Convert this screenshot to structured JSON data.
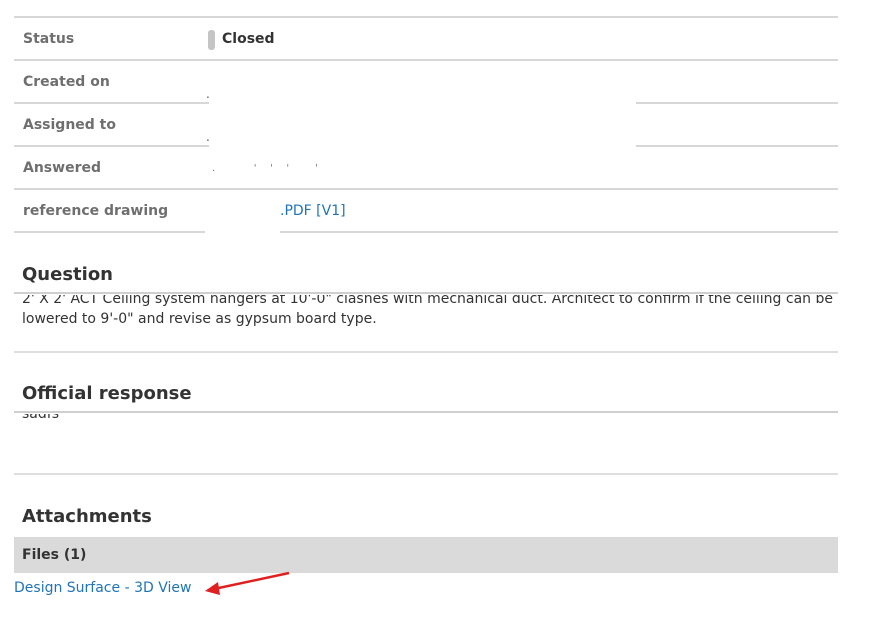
{
  "details": {
    "status_label": "Status",
    "status_value": "Closed",
    "created_label": "Created on",
    "assigned_label": "Assigned to",
    "answered_label": "Answered",
    "reference_label": "reference drawing",
    "reference_link": ".PDF [V1]"
  },
  "question": {
    "title": "Question",
    "line1": "2' X 2' ACT Ceiling system hangers at 10'-0\" clashes with mechanical duct. Architect to confirm if the ceiling can be",
    "line2": "lowered to 9'-0\" and revise as gypsum board type."
  },
  "response": {
    "title": "Official response",
    "text": "sadfs"
  },
  "attachments": {
    "title": "Attachments",
    "files_header": "Files (1)",
    "file_link": "Design Surface - 3D View"
  },
  "colors": {
    "link": "#1f74b8",
    "arrow": "#e02020"
  }
}
